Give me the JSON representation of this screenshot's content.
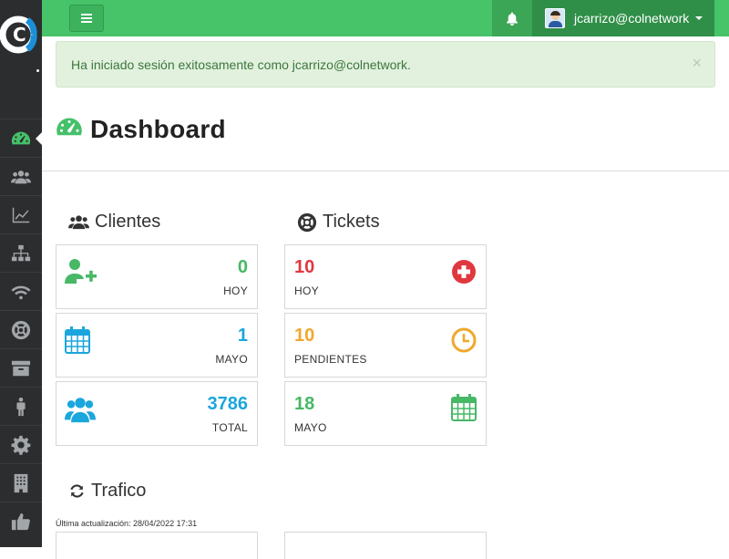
{
  "topbar": {
    "menu_icon": "bars-icon",
    "bell_icon": "bell-icon",
    "user_email": "jcarrizo@colnetwork"
  },
  "alert": {
    "message": "Ha iniciado sesión exitosamente como jcarrizo@colnetwork.",
    "close_label": "×"
  },
  "page": {
    "title": "Dashboard"
  },
  "sidebar": {
    "items": [
      {
        "icon": "dashboard-icon",
        "active": true
      },
      {
        "icon": "users-icon"
      },
      {
        "icon": "line-chart-icon"
      },
      {
        "icon": "sitemap-icon"
      },
      {
        "icon": "wifi-icon"
      },
      {
        "icon": "lifebuoy-icon"
      },
      {
        "icon": "archive-icon"
      },
      {
        "icon": "person-icon"
      },
      {
        "icon": "cog-icon"
      },
      {
        "icon": "building-icon"
      },
      {
        "icon": "thumbs-up-icon"
      }
    ]
  },
  "clientes": {
    "title": "Clientes",
    "cards": [
      {
        "value": "0",
        "label": "HOY",
        "icon": "user-plus-icon",
        "color": "#47b865"
      },
      {
        "value": "1",
        "label": "MAYO",
        "icon": "calendar-icon",
        "color": "#1ba6dd"
      },
      {
        "value": "3786",
        "label": "TOTAL",
        "icon": "users-icon",
        "color": "#1ba6dd"
      }
    ]
  },
  "tickets": {
    "title": "Tickets",
    "cards": [
      {
        "value": "10",
        "label": "HOY",
        "icon": "plus-circle-icon",
        "color": "#e0383e"
      },
      {
        "value": "10",
        "label": "PENDIENTES",
        "icon": "clock-icon",
        "color": "#f0a82c"
      },
      {
        "value": "18",
        "label": "MAYO",
        "icon": "calendar-icon",
        "color": "#47b865"
      }
    ]
  },
  "trafico": {
    "title": "Trafico",
    "updated": "Última actualización: 28/04/2022 17:31"
  },
  "colors": {
    "topbar": "#47c369",
    "sidebar": "#2b2d2f",
    "alert_bg": "#e2f1de",
    "alert_text": "#3c763d"
  }
}
